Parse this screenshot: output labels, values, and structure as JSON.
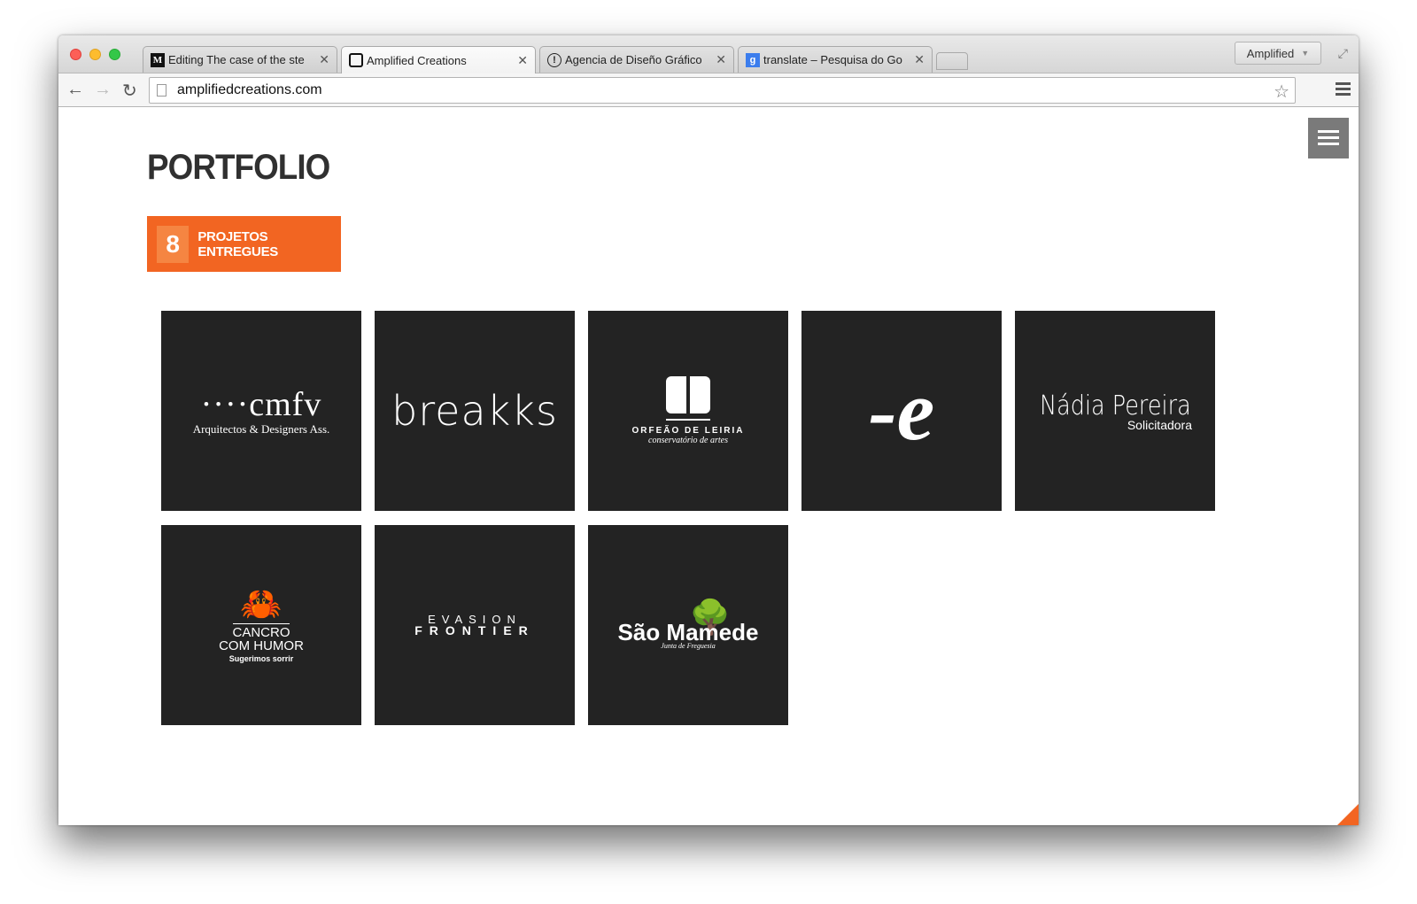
{
  "browser": {
    "tabs": [
      {
        "favicon": "M",
        "title": "Editing The case of the ste",
        "active": false
      },
      {
        "favicon": "",
        "title": "Amplified Creations",
        "active": true
      },
      {
        "favicon": "!",
        "title": "Agencia de Diseño Gráfico",
        "active": false
      },
      {
        "favicon": "g",
        "title": "translate – Pesquisa do Go",
        "active": false
      }
    ],
    "profile_name": "Amplified",
    "url": "amplifiedcreations.com",
    "icons": {
      "back": "back-arrow-icon",
      "forward": "forward-arrow-icon",
      "reload": "reload-icon",
      "bookmark": "star-icon",
      "menu": "hamburger-menu-icon"
    }
  },
  "page": {
    "title": "PORTFOLIO",
    "badge": {
      "count": "8",
      "label": "PROJETOS ENTREGUES"
    },
    "accent_color": "#f26522",
    "tile_color": "#232323",
    "projects": [
      {
        "main": "····cmfv",
        "sub": "Arquitectos & Designers Ass."
      },
      {
        "main": "breakks"
      },
      {
        "name": "ORFEÃO DE LEIRIA",
        "sub": "conservatório de artes"
      },
      {
        "main": "-e"
      },
      {
        "main": "Nádia Pereira",
        "sub": "Solicitadora"
      },
      {
        "line1": "CANCRO",
        "line2": "COM HUMOR",
        "sub": "Sugerimos sorrir"
      },
      {
        "top": "EVASION",
        "bottom": "FRONTIER"
      },
      {
        "main": "São Mamede",
        "sub": "Junta de Freguesia"
      }
    ]
  }
}
